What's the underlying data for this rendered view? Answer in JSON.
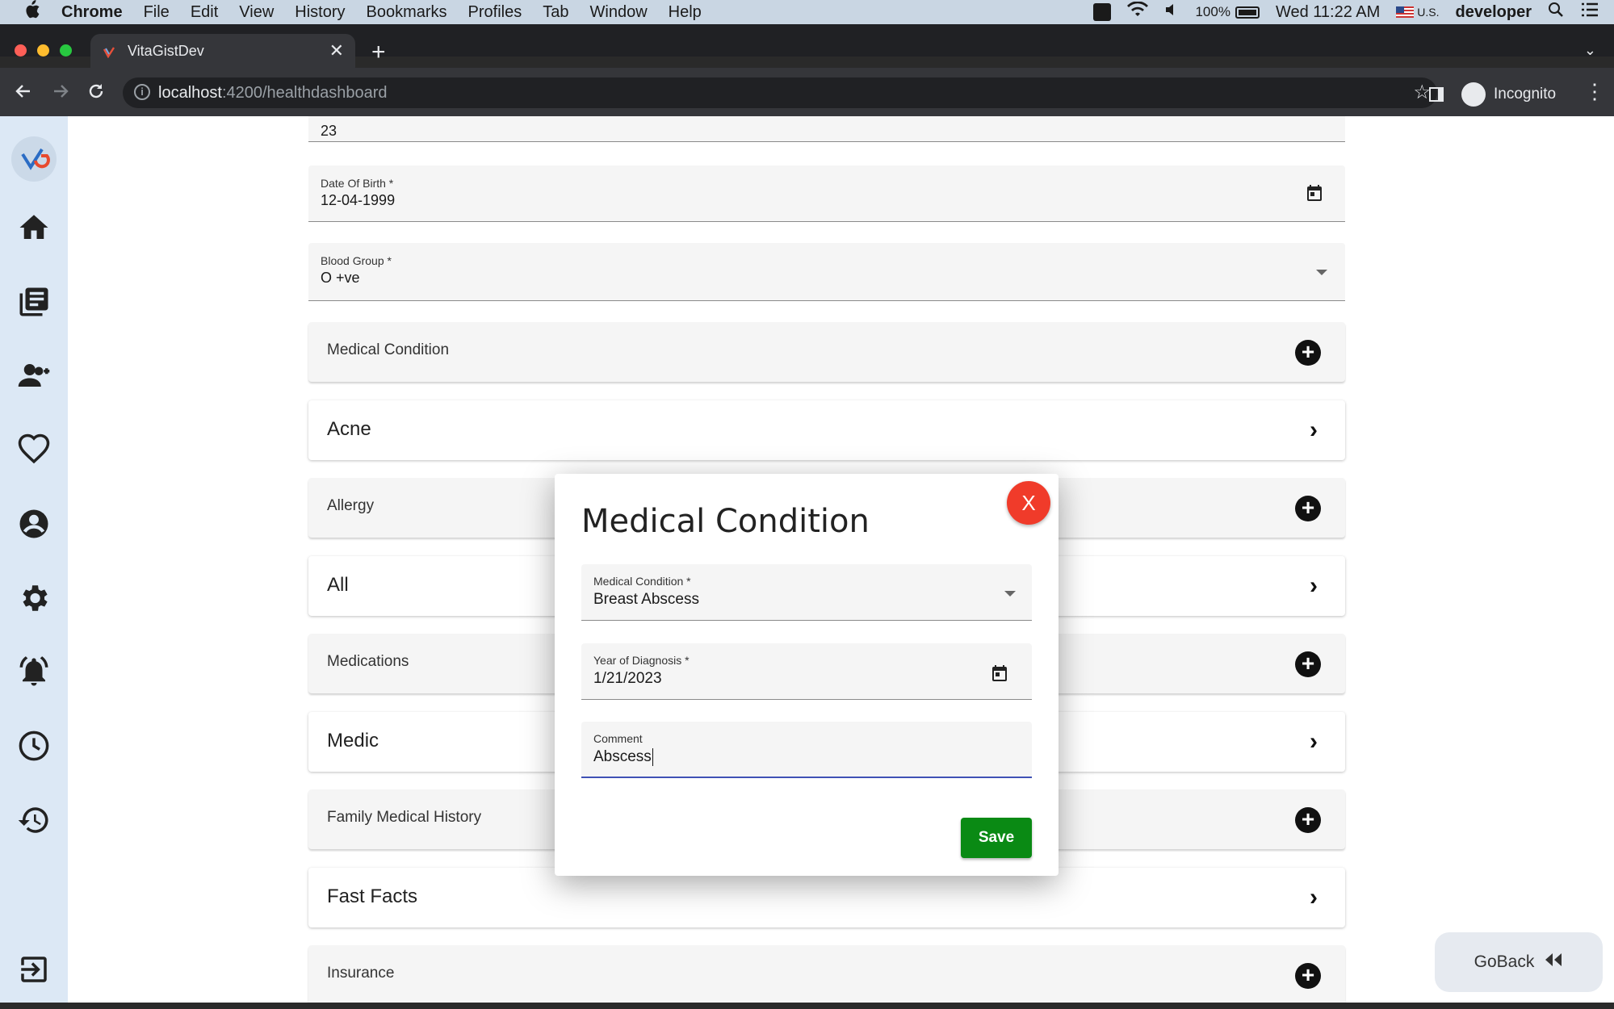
{
  "menubar": {
    "app": "Chrome",
    "items": [
      "File",
      "Edit",
      "View",
      "History",
      "Bookmarks",
      "Profiles",
      "Tab",
      "Window",
      "Help"
    ],
    "battery": "100%",
    "datetime": "Wed 11:22 AM",
    "input_source": "U.S.",
    "user": "developer"
  },
  "browser": {
    "tab_title": "VitaGistDev",
    "url_host": "localhost",
    "url_path": ":4200/healthdashboard",
    "profile_label": "Incognito"
  },
  "form": {
    "age_value": "23",
    "dob_label": "Date Of Birth *",
    "dob_value": "12-04-1999",
    "blood_label": "Blood Group *",
    "blood_value": "O +ve"
  },
  "sections": [
    {
      "title": "Medical Condition",
      "kind": "add"
    },
    {
      "title": "Acne",
      "kind": "item"
    },
    {
      "title": "Allergy",
      "kind": "add"
    },
    {
      "title": "All",
      "kind": "item"
    },
    {
      "title": "Medications",
      "kind": "add"
    },
    {
      "title": "Medic",
      "kind": "item"
    },
    {
      "title": "Family Medical History",
      "kind": "add"
    },
    {
      "title": "Fast Facts",
      "kind": "item"
    },
    {
      "title": "Insurance",
      "kind": "add"
    }
  ],
  "goback_label": "GoBack",
  "modal": {
    "title": "Medical Condition",
    "close_label": "X",
    "condition_label": "Medical Condition *",
    "condition_value": "Breast Abscess",
    "year_label": "Year of Diagnosis *",
    "year_value": "1/21/2023",
    "comment_label": "Comment",
    "comment_value": "Abscess",
    "save_label": "Save"
  },
  "colors": {
    "sidebar": "#dce8f5",
    "close_button": "#f03b2a",
    "save_button": "#0a8a14",
    "focus_underline": "#3f51b5"
  }
}
